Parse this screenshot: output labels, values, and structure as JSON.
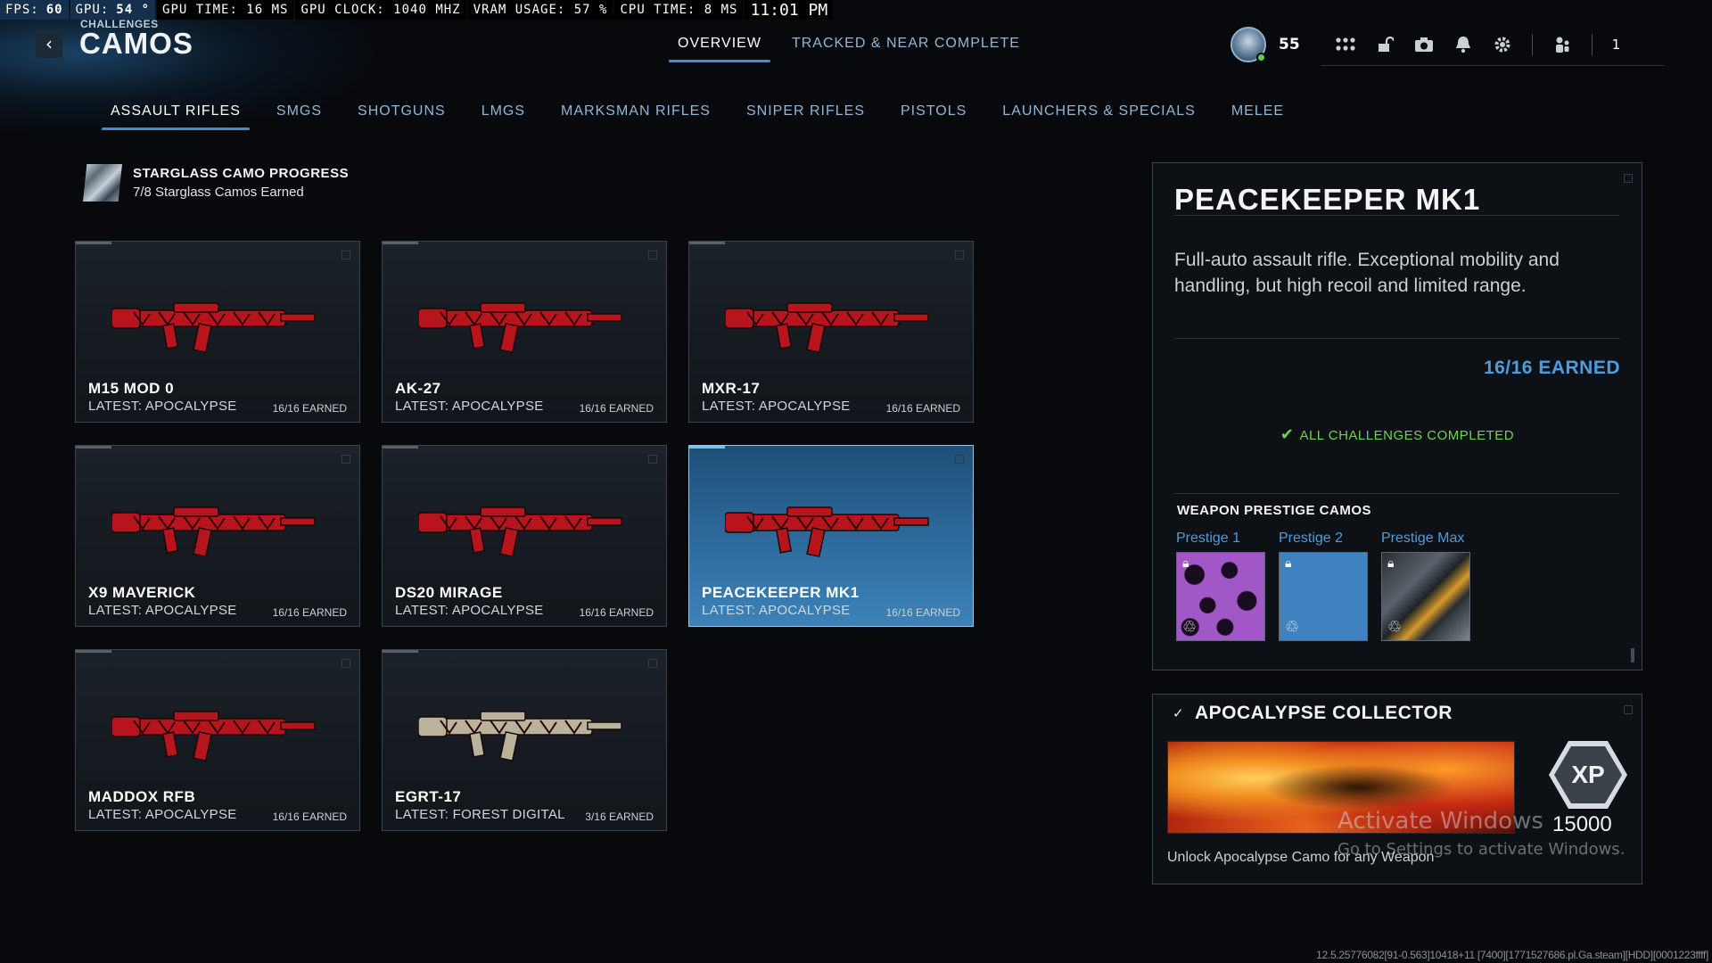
{
  "perf": {
    "fps_label": "FPS:",
    "fps": "60",
    "gpu_label": "GPU:",
    "gpu": "54 °",
    "gpu_time": "GPU TIME: 16 MS",
    "gpu_clock": "GPU CLOCK: 1040 MHZ",
    "vram": "VRAM USAGE: 57 %",
    "cpu_time": "CPU TIME:  8 MS",
    "clock": "11:01 PM"
  },
  "header": {
    "back_icon": "chevron-left-icon",
    "subtitle": "CHALLENGES",
    "title": "CAMOS",
    "tabs": [
      {
        "label": "OVERVIEW",
        "active": true
      },
      {
        "label": "TRACKED & NEAR COMPLETE",
        "active": false
      }
    ],
    "level": "55",
    "party_count": "1",
    "icons": [
      "apps-grid-icon",
      "unlock-icon",
      "camera-icon",
      "bell-icon",
      "gear-icon",
      "party-icon"
    ]
  },
  "categories": [
    {
      "label": "ASSAULT RIFLES",
      "active": true
    },
    {
      "label": "SMGS"
    },
    {
      "label": "SHOTGUNS"
    },
    {
      "label": "LMGS"
    },
    {
      "label": "MARKSMAN RIFLES"
    },
    {
      "label": "SNIPER RIFLES"
    },
    {
      "label": "PISTOLS"
    },
    {
      "label": "LAUNCHERS & SPECIALS"
    },
    {
      "label": "MELEE"
    }
  ],
  "starglass": {
    "title": "STARGLASS CAMO PROGRESS",
    "subtitle": "7/8 Starglass Camos Earned"
  },
  "weapons": [
    {
      "name": "M15 MOD 0",
      "latest": "LATEST: APOCALYPSE",
      "earned": "16/16 EARNED",
      "camo_color": "#b8141c"
    },
    {
      "name": "AK-27",
      "latest": "LATEST: APOCALYPSE",
      "earned": "16/16 EARNED",
      "camo_color": "#b8141c"
    },
    {
      "name": "MXR-17",
      "latest": "LATEST: APOCALYPSE",
      "earned": "16/16 EARNED",
      "camo_color": "#b8141c"
    },
    {
      "name": "X9 MAVERICK",
      "latest": "LATEST: APOCALYPSE",
      "earned": "16/16 EARNED",
      "camo_color": "#b8141c"
    },
    {
      "name": "DS20 MIRAGE",
      "latest": "LATEST: APOCALYPSE",
      "earned": "16/16 EARNED",
      "camo_color": "#b8141c"
    },
    {
      "name": "PEACEKEEPER MK1",
      "latest": "LATEST: APOCALYPSE",
      "earned": "16/16 EARNED",
      "camo_color": "#b8141c",
      "selected": true
    },
    {
      "name": "MADDOX RFB",
      "latest": "LATEST: APOCALYPSE",
      "earned": "16/16 EARNED",
      "camo_color": "#b8141c"
    },
    {
      "name": "EGRT-17",
      "latest": "LATEST: FOREST DIGITAL",
      "earned": "3/16 EARNED",
      "camo_color": "#b9b39c"
    }
  ],
  "detail": {
    "title": "PEACEKEEPER MK1",
    "description": "Full-auto assault rifle. Exceptional mobility and handling, but high recoil and limited range.",
    "earned": "16/16 EARNED",
    "complete_label": "ALL CHALLENGES COMPLETED",
    "prestige_title": "WEAPON PRESTIGE CAMOS",
    "prestige": [
      {
        "label": "Prestige 1",
        "icon": "lock-icon"
      },
      {
        "label": "Prestige 2",
        "icon": "lock-icon"
      },
      {
        "label": "Prestige Max",
        "icon": "lock-icon"
      }
    ]
  },
  "collector": {
    "title": "APOCALYPSE COLLECTOR",
    "xp_badge": "XP",
    "xp_amount": "15000",
    "description": "Unlock Apocalypse Camo for any Weapon"
  },
  "watermark": {
    "line1": "Activate Windows",
    "line2": "Go to Settings to activate Windows."
  },
  "build_string": "12.5.25776082[91-0.563]10418+11 [7400][1771527686.pl.Ga.steam][HDD][0001223ffff]"
}
